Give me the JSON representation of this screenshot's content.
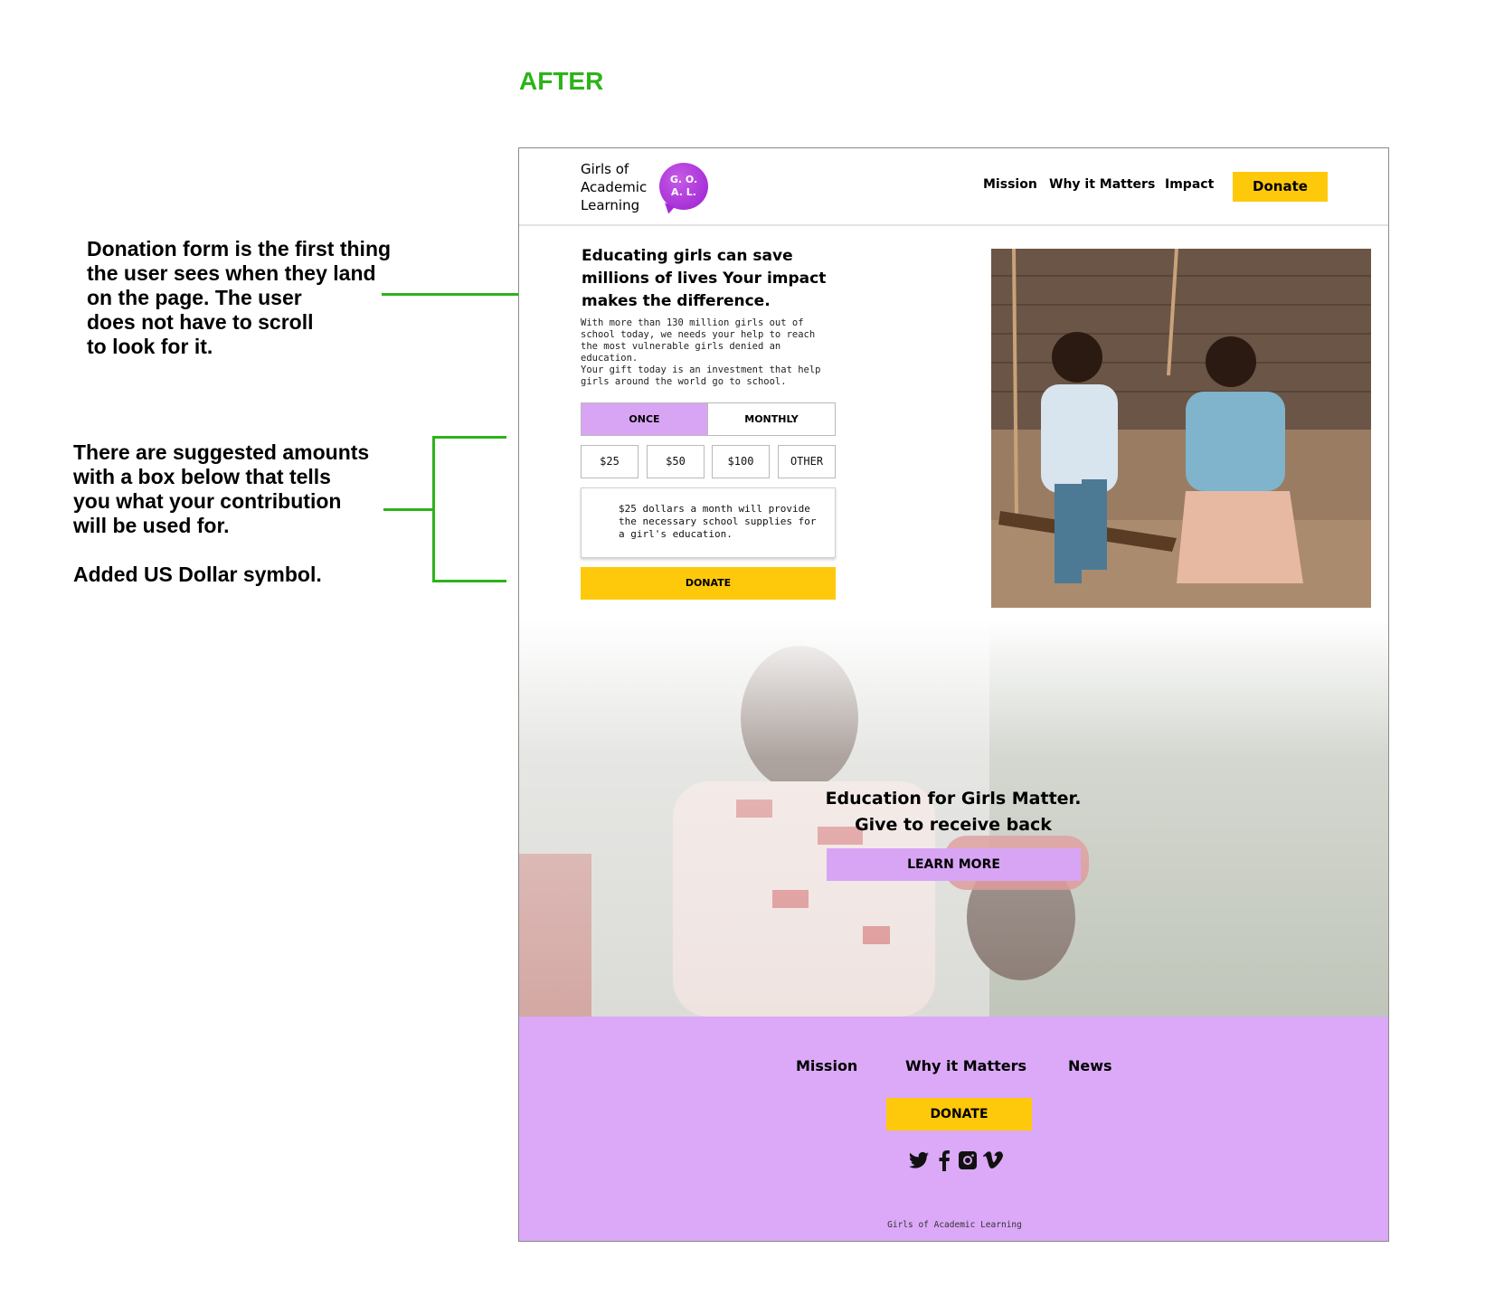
{
  "annotation": {
    "heading": "AFTER",
    "note_donation_form": "Donation form is the first thing\nthe user sees when they land\non the page. The user\ndoes not have to scroll\nto look for it.",
    "note_suggested_amounts": "There are suggested amounts\nwith a box below that tells\nyou what your contribution\nwill be used for.",
    "note_dollar": "Added US Dollar symbol.",
    "accent_color": "#2db31a"
  },
  "header": {
    "brand_lines": [
      "Girls of",
      "Academic",
      "Learning"
    ],
    "logo_line1": "G. O.",
    "logo_line2": "A. L.",
    "nav": [
      "Mission",
      "Why it Matters",
      "Impact"
    ],
    "donate_label": "Donate"
  },
  "hero": {
    "title": "Educating girls can save millions of lives Your impact makes the difference.",
    "paragraph1": "With more than 130 million girls out of school today, we needs your help to reach the most vulnerable girls denied an education.",
    "paragraph2": "Your gift today is an investment that help girls around the world go to school.",
    "frequency": {
      "once": "ONCE",
      "monthly": "MONTHLY",
      "selected": "ONCE"
    },
    "amounts": [
      "$25",
      "$50",
      "$100",
      "OTHER"
    ],
    "info_text": "$25 dollars a month will provide the necessary school supplies for a girl's education.",
    "donate_label": "DONATE",
    "image_icon": "children-on-swing-photo"
  },
  "section2": {
    "title_line1": "Education for Girls Matter.",
    "title_line2": "Give to receive back",
    "button_label": "LEARN MORE",
    "image_icon": "two-girls-photo"
  },
  "footer": {
    "links": [
      "Mission",
      "Why it Matters",
      "News"
    ],
    "donate_label": "DONATE",
    "social_icons": [
      "twitter-icon",
      "facebook-icon",
      "instagram-icon",
      "vimeo-icon"
    ],
    "copyright": "Girls of Academic Learning"
  },
  "colors": {
    "brand_purple": "#dba9f7",
    "selected_purple": "#d8a5f4",
    "logo_purple": "#a42ad4",
    "donate_yellow": "#ffc90b"
  }
}
